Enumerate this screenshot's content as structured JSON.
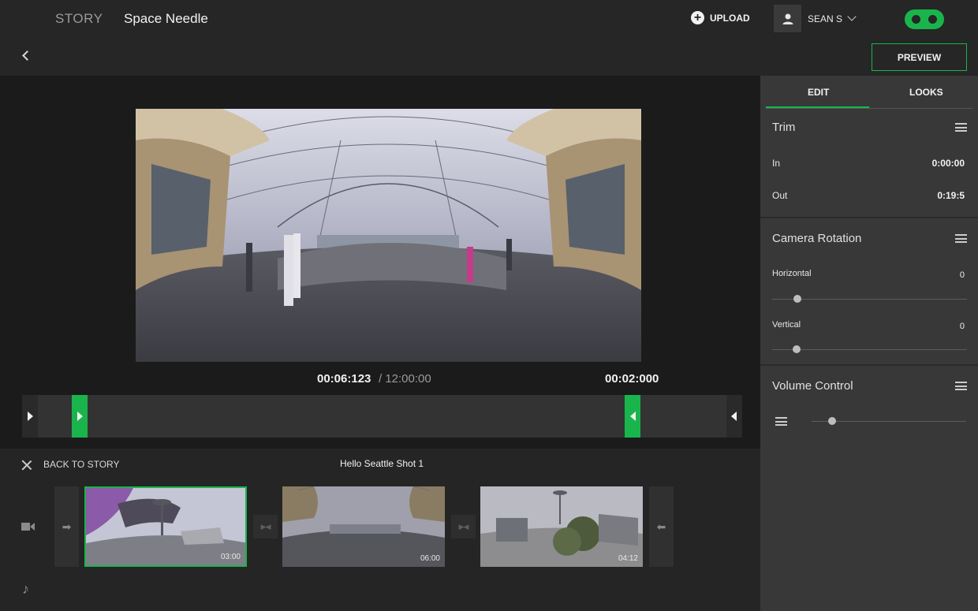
{
  "header": {
    "story_label": "STORY",
    "title": "Space Needle",
    "upload_label": "UPLOAD",
    "user_name": "SEAN S",
    "preview_label": "PREVIEW"
  },
  "player": {
    "current_time": "00:06:123",
    "total_time": "/ 12:00:00",
    "clip_duration": "00:02:000"
  },
  "panel": {
    "tabs": [
      {
        "label": "EDIT",
        "active": true
      },
      {
        "label": "LOOKS",
        "active": false
      }
    ],
    "trim": {
      "title": "Trim",
      "in_label": "In",
      "in_value": "0:00:00",
      "out_label": "Out",
      "out_value": "0:19:5"
    },
    "camera_rotation": {
      "title": "Camera Rotation",
      "horizontal_label": "Horizontal",
      "horizontal_value": "0",
      "vertical_label": "Vertical",
      "vertical_value": "0"
    },
    "volume": {
      "title": "Volume Control"
    }
  },
  "timeline": {
    "back_label": "BACK TO STORY",
    "shot_title": "Hello Seattle Shot 1",
    "clips": [
      {
        "duration": "03:00",
        "selected": true
      },
      {
        "duration": "06:00",
        "selected": false
      },
      {
        "duration": "04:12",
        "selected": false
      }
    ]
  },
  "colors": {
    "accent": "#19b54c",
    "background": "#1b1b1b",
    "panel": "#383838"
  }
}
